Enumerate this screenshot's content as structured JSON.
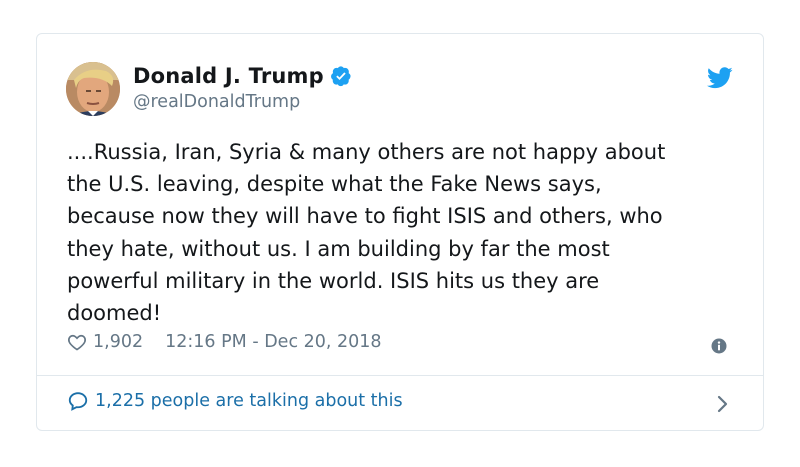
{
  "tweet": {
    "author": {
      "display_name": "Donald J. Trump",
      "handle": "@realDonaldTrump",
      "verified": true
    },
    "text": "....Russia, Iran, Syria & many others are not happy about\nthe U.S. leaving, despite what the Fake News says,\nbecause now they will have to fight ISIS and others, who\nthey hate, without us. I am building by far the most\npowerful military in the world. ISIS hits us they are\ndoomed!",
    "likes": "1,902",
    "timestamp": "12:16 PM - Dec 20, 2018",
    "talking_about": "1,225 people are talking about this"
  },
  "icons": {
    "avatar": "avatar-photo",
    "verified": "verified-badge-icon",
    "brand": "twitter-bird-icon",
    "like": "heart-icon",
    "info": "info-icon",
    "reply": "speech-bubble-icon",
    "more": "chevron-right-icon"
  },
  "colors": {
    "text": "#14171a",
    "secondary": "#657786",
    "accent": "#1da1f2",
    "link": "#1b6fa8",
    "border": "#e1e8ed"
  }
}
